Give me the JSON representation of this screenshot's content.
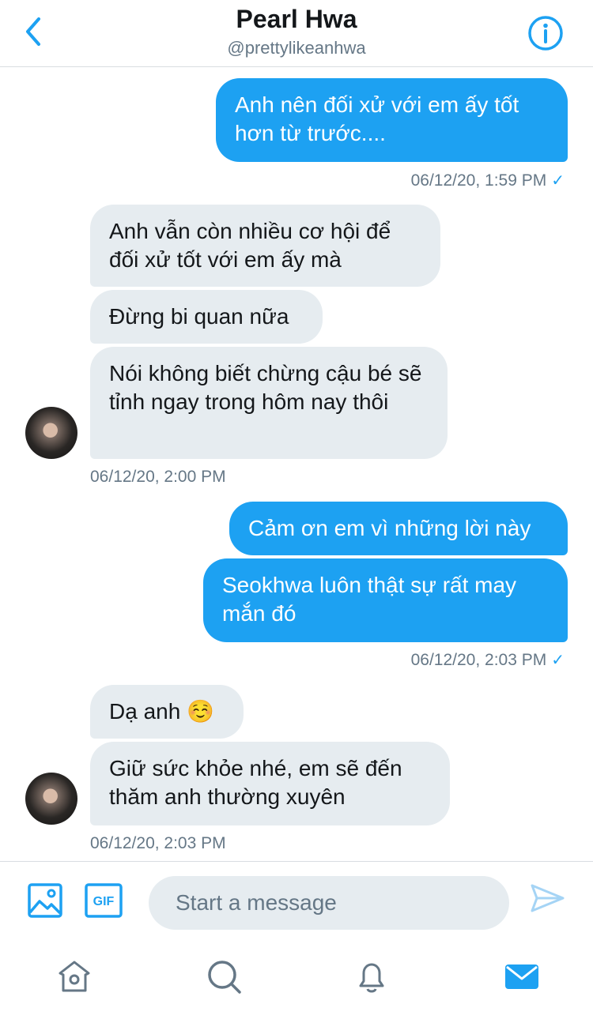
{
  "header": {
    "title": "Pearl Hwa",
    "handle": "@prettylikeanhwa"
  },
  "messages": [
    {
      "dir": "out",
      "text": "Anh nên đối xử với em ấy tốt hơn từ trước...."
    },
    {
      "dir": "in",
      "text": "Anh vẫn còn nhiều cơ hội để đối xử tốt với em ấy mà"
    },
    {
      "dir": "in",
      "text": "Đừng bi quan nữa"
    },
    {
      "dir": "in",
      "text": "Nói không biết chừng cậu bé sẽ tỉnh ngay trong hôm nay thôi"
    },
    {
      "dir": "out",
      "text": "Cảm ơn em vì những lời này"
    },
    {
      "dir": "out",
      "text": "Seokhwa luôn thật sự rất may mắn đó"
    },
    {
      "dir": "in",
      "text": "Dạ anh ☺️"
    },
    {
      "dir": "in",
      "text": "Giữ sức khỏe nhé, em sẽ đến thăm anh thường xuyên"
    }
  ],
  "timestamps": {
    "t1": "06/12/20, 1:59 PM",
    "t2": "06/12/20, 2:00 PM",
    "t3": "06/12/20, 2:03 PM",
    "t4": "06/12/20, 2:03 PM",
    "check": "✓"
  },
  "composer": {
    "placeholder": "Start a message",
    "gif_label": "GIF"
  },
  "icons": {
    "back": "chevron-left-icon",
    "info": "info-icon",
    "image": "image-icon",
    "gif": "gif-icon",
    "send": "send-icon",
    "home": "home-icon",
    "search": "search-icon",
    "notifications": "bell-icon",
    "messages": "mail-icon"
  },
  "colors": {
    "accent": "#1da1f2",
    "incoming_bubble": "#e6ecf0",
    "muted_text": "#657786"
  }
}
